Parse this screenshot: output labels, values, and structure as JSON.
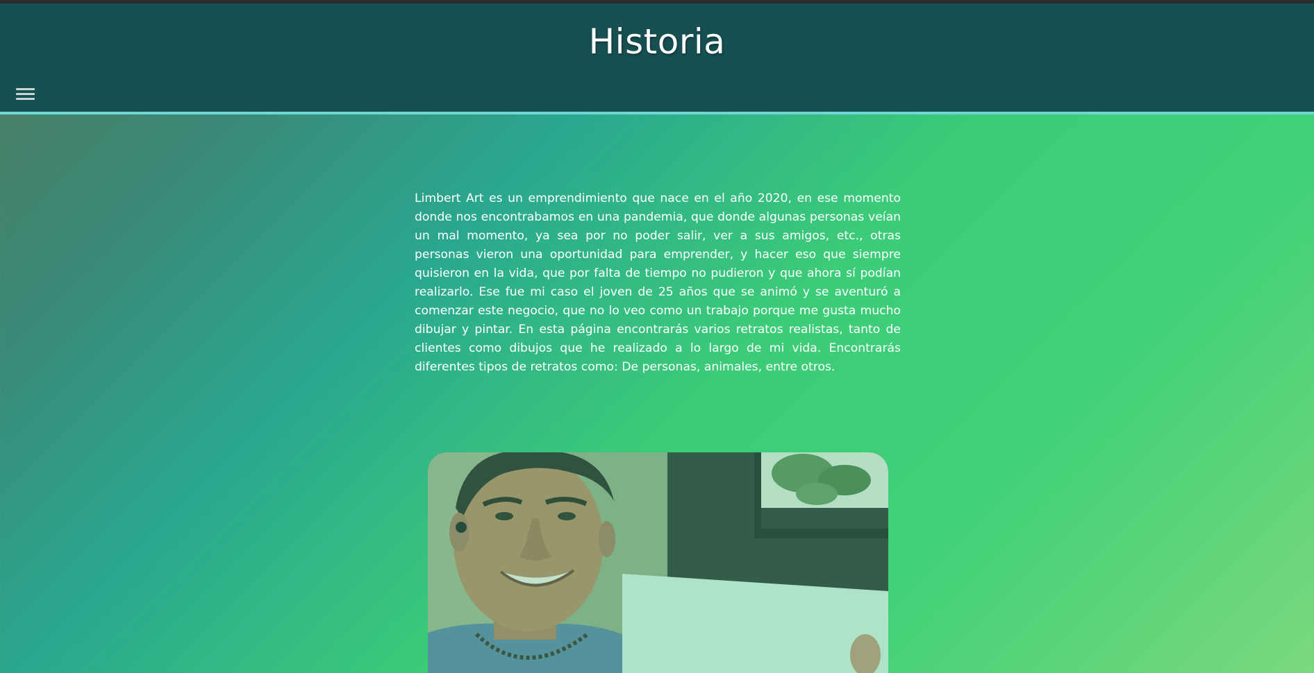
{
  "header": {
    "title": "Historia",
    "menu_icon": "hamburger-menu-icon"
  },
  "main": {
    "story_text": "Limbert Art es un emprendimiento que nace en el año 2020, en ese momento donde nos encontrabamos en una pandemia, que donde algunas personas veían un mal momento, ya sea por no poder salir, ver a sus amigos, etc., otras personas vieron una oportunidad para emprender, y hacer eso que siempre quisieron en la vida, que por falta de tiempo no pudieron y que ahora sí podían realizarlo. Ese fue mi caso el joven de 25 años que se animó y se aventuró a comenzar este negocio, que no lo veo como un trabajo porque me gusta mucho dibujar y pintar. En esta página encontrarás varios retratos realistas, tanto de clientes como dibujos que he realizado a lo largo de mi vida. Encontrarás diferentes tipos de retratos como: De personas, animales, entre otros.",
    "photo": "artist-portrait-photo"
  },
  "colors": {
    "header_bg": "#175052",
    "header_border": "#6fd6d4",
    "text": "#ffffff",
    "gradient_start": "#4d7a5f",
    "gradient_mid": "#3ccb78",
    "gradient_end": "#7bd87d"
  }
}
